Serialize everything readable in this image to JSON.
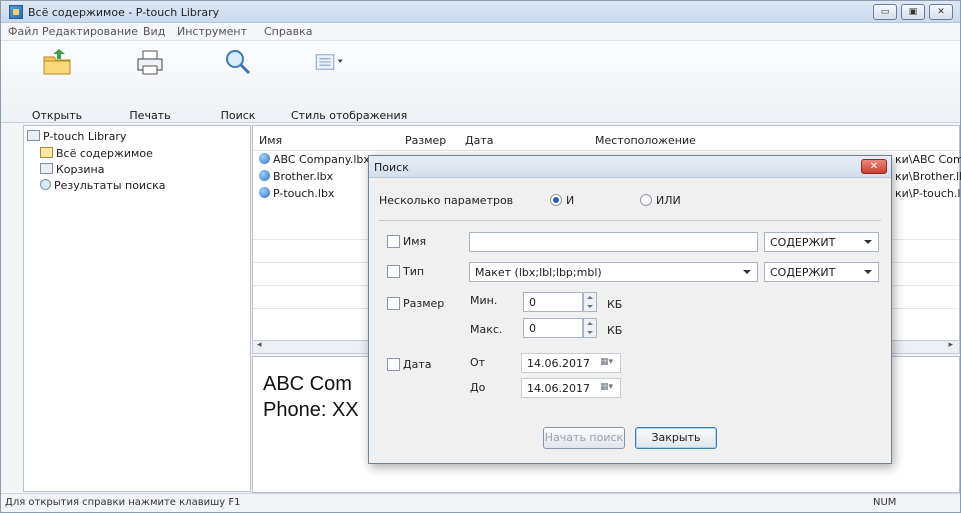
{
  "window": {
    "title": "Всё содержимое - P-touch Library",
    "min": "▭",
    "max": "▣",
    "close": "✕"
  },
  "menu": [
    "Файл",
    "Редактирование",
    "Вид",
    "Инструмент",
    "Справка"
  ],
  "toolbar": {
    "open": "Открыть",
    "print": "Печать",
    "search": "Поиск",
    "view_style": "Стиль отображения"
  },
  "tree": {
    "root": "P-touch Library",
    "items": [
      "Всё содержимое",
      "Корзина",
      "Результаты поиска"
    ]
  },
  "list": {
    "headers": {
      "name": "Имя",
      "size": "Размер",
      "date": "Дата",
      "location": "Местоположение"
    },
    "rows": [
      {
        "name": "ABC Company.lbx",
        "location_tail": "ки\\ABC Com"
      },
      {
        "name": "Brother.lbx",
        "location_tail": "ки\\Brother.lb"
      },
      {
        "name": "P-touch.lbx",
        "location_tail": "ки\\P-touch.lb"
      }
    ]
  },
  "preview": {
    "line1": "ABC Com",
    "line2": "Phone: XX"
  },
  "status": {
    "help": "Для открытия справки нажмите клавишу F1",
    "num": "NUM"
  },
  "dialog": {
    "title": "Поиск",
    "multi_label": "Несколько параметров",
    "and": "И",
    "or": "ИЛИ",
    "name_label": "Имя",
    "name_value": "",
    "contains": "СОДЕРЖИТ",
    "type_label": "Тип",
    "type_value": "Макет (lbx;lbl;lbp;mbl)",
    "size_label": "Размер",
    "min_label": "Мин.",
    "min_value": "0",
    "max_label": "Макс.",
    "max_value": "0",
    "kb": "КБ",
    "date_label": "Дата",
    "from_label": "От",
    "from_value": "14.06.2017",
    "to_label": "До",
    "to_value": "14.06.2017",
    "start": "Начать поиск",
    "close": "Закрыть"
  }
}
